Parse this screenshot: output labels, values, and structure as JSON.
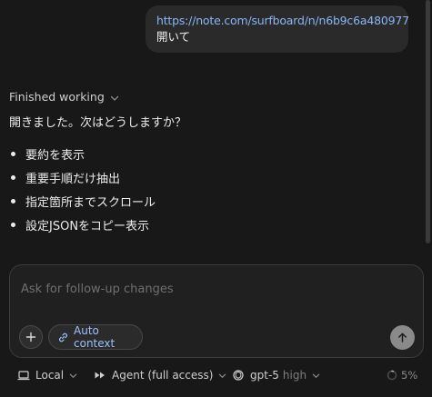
{
  "user_message": {
    "link": "https://note.com/surfboard/n/n6b9c6a480977",
    "text": "開いて"
  },
  "assistant": {
    "status": "Finished working",
    "reply": "開きました。次はどうしますか？",
    "options": [
      "要約を表示",
      "重要手順だけ抽出",
      "指定箇所までスクロール",
      "設定JSONをコピー表示"
    ]
  },
  "composer": {
    "placeholder": "Ask for follow-up changes",
    "context_chip": "Auto context",
    "icons": {
      "plus": "plus-icon",
      "context": "link-icon",
      "send": "arrow-up-icon"
    }
  },
  "toolbar": {
    "env_label": "Local",
    "mode_label": "Agent (full access)",
    "model_label": "gpt-5",
    "effort_label": "high",
    "usage_label": "5%",
    "usage_fraction": 0.05,
    "icons": {
      "env": "monitor-icon",
      "mode": "fast-forward-icon",
      "model": "openai-icon",
      "usage": "progress-ring-icon"
    }
  },
  "colors": {
    "background": "#181818",
    "link": "#8ab4f8",
    "chip_text": "#9cc0ff",
    "bubble": "#2a2a2a",
    "send_button": "#8a8a8a"
  }
}
